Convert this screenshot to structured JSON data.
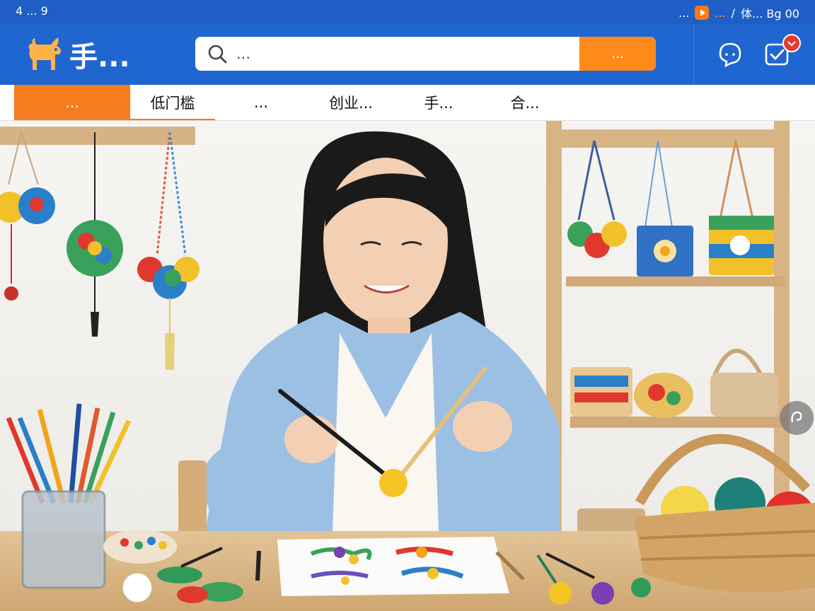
{
  "topbar": {
    "left_text": "4 ... 9",
    "right_text": "...",
    "hot_text": "...",
    "right_tail": "体... Bg 00"
  },
  "header": {
    "logo_text": "手...",
    "search_placeholder": "...",
    "search_button": "..."
  },
  "nav": {
    "tabs": [
      {
        "label": "...",
        "active": true
      },
      {
        "label": "低门槛"
      },
      {
        "label": "..."
      },
      {
        "label": "创业..."
      },
      {
        "label": "手..."
      },
      {
        "label": "合..."
      }
    ]
  },
  "colors": {
    "topbar_bg": "#1f5fc5",
    "header_bg": "#1f66d1",
    "accent_orange": "#f57c1f",
    "badge_red": "#e53b2c"
  },
  "icons": {
    "logo": "deer-icon",
    "search": "search-icon",
    "message": "chat-bubble-icon",
    "tasks": "checkbox-icon",
    "side": "share-icon",
    "topbar": "play-icon"
  },
  "hero": {
    "description_visible_text": ""
  }
}
